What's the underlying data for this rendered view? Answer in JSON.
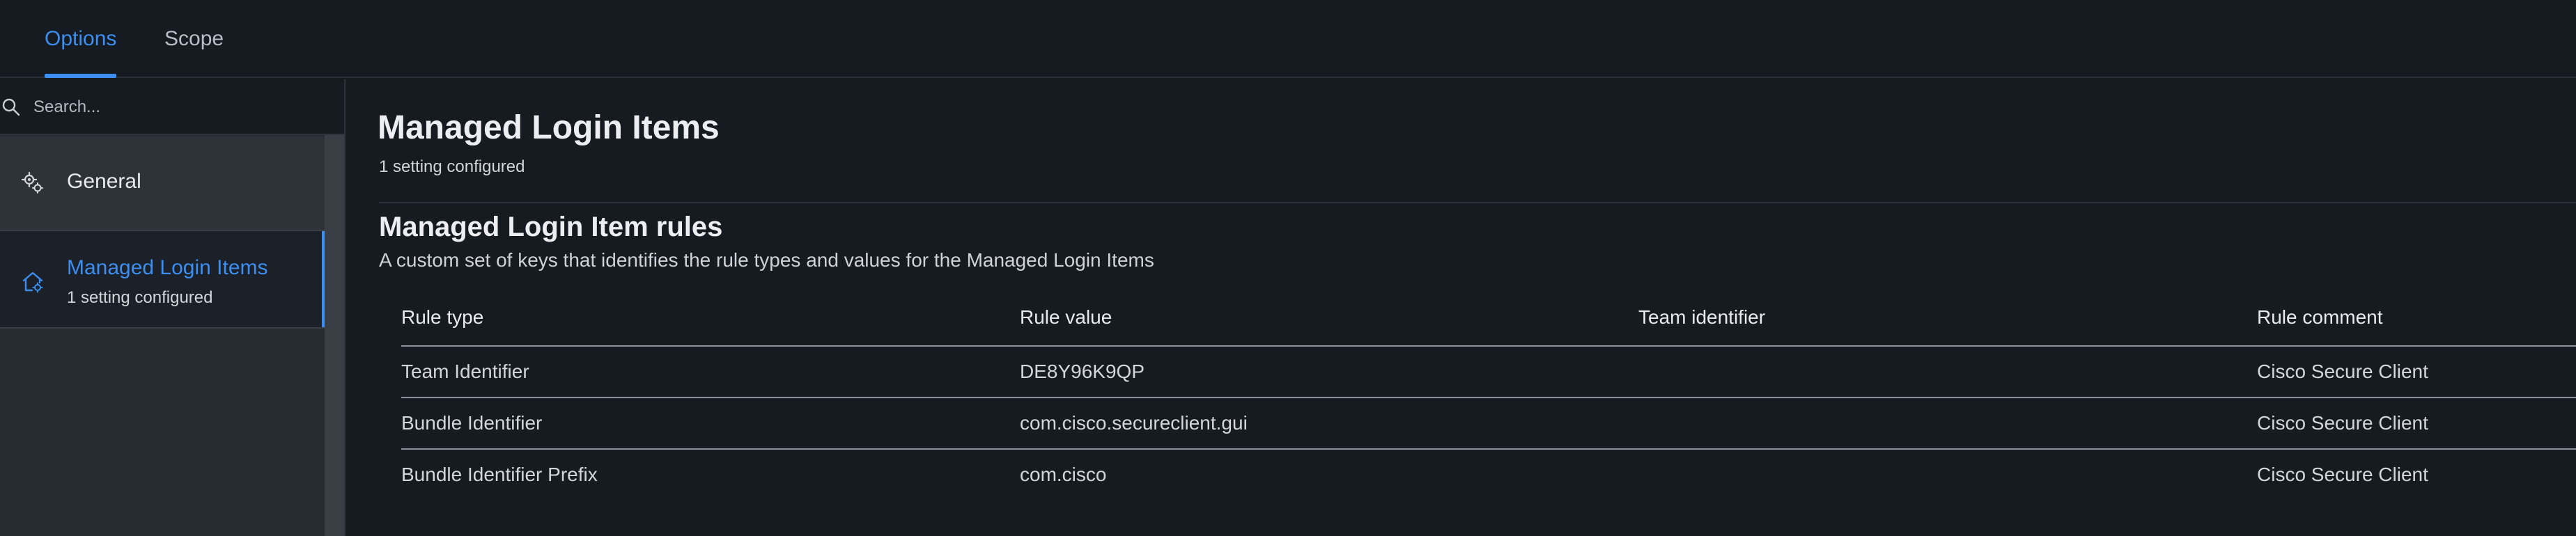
{
  "tabs": {
    "options": "Options",
    "scope": "Scope"
  },
  "sidebar": {
    "search_placeholder": "Search...",
    "items": [
      {
        "label": "General",
        "icon": "gear-icon"
      },
      {
        "label": "Managed Login Items",
        "sub": "1 setting configured",
        "icon": "home-gear-icon",
        "selected": true
      }
    ]
  },
  "main": {
    "title": "Managed Login Items",
    "subtitle": "1 setting configured",
    "section": {
      "title": "Managed Login Item rules",
      "description": "A custom set of keys that identifies the rule types and values for the Managed Login Items"
    },
    "table": {
      "headers": [
        "Rule type",
        "Rule value",
        "Team identifier",
        "Rule comment"
      ],
      "rows": [
        [
          "Team Identifier",
          "DE8Y96K9QP",
          "",
          "Cisco Secure Client"
        ],
        [
          "Bundle Identifier",
          "com.cisco.secureclient.gui",
          "",
          "Cisco Secure Client"
        ],
        [
          "Bundle Identifier Prefix",
          "com.cisco",
          "",
          "Cisco Secure Client"
        ]
      ]
    }
  },
  "colors": {
    "accent": "#3c8ef0",
    "background": "#161a21",
    "sidebar": "#272c33"
  }
}
